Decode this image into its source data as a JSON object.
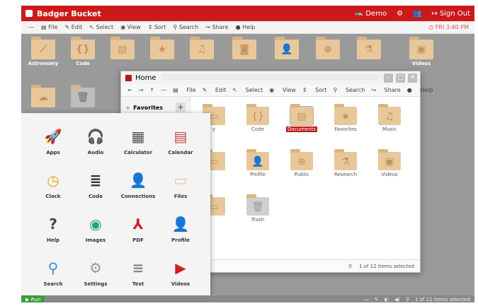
{
  "topbar": {
    "title": "Badger Bucket",
    "user": "Demo",
    "sign_out": "Sign Out"
  },
  "menubar": {
    "items": [
      "File",
      "Edit",
      "Select",
      "View",
      "Sort",
      "Search",
      "Share",
      "Help"
    ],
    "clock": "FRI 3:40 PM"
  },
  "desktop": {
    "icons": [
      {
        "label": "Astronomy",
        "icon": "telescope-icon"
      },
      {
        "label": "Code",
        "icon": "braces-icon"
      },
      {
        "label": "",
        "icon": "document-icon"
      },
      {
        "label": "",
        "icon": "star-icon"
      },
      {
        "label": "",
        "icon": "music-icon"
      },
      {
        "label": "",
        "icon": "camera-icon"
      },
      {
        "label": "",
        "icon": "person-icon"
      },
      {
        "label": "",
        "icon": "globe-icon"
      },
      {
        "label": "",
        "icon": "flask-icon"
      },
      {
        "label": "Videos",
        "icon": "film-icon"
      }
    ]
  },
  "window": {
    "title": "Home",
    "toolbar": [
      "File",
      "Edit",
      "Select",
      "View",
      "Sort",
      "Search",
      "Share",
      "Help"
    ],
    "sidebar_favorites": "Favorites",
    "items": [
      {
        "label": "y",
        "icon": "folder-icon"
      },
      {
        "label": "Code",
        "icon": "braces-icon"
      },
      {
        "label": "Documents",
        "icon": "document-icon",
        "selected": true
      },
      {
        "label": "Favorites",
        "icon": "star-icon"
      },
      {
        "label": "Music",
        "icon": "music-icon"
      },
      {
        "label": "",
        "icon": "folder-icon"
      },
      {
        "label": "Profile",
        "icon": "person-icon"
      },
      {
        "label": "Public",
        "icon": "globe-icon"
      },
      {
        "label": "Research",
        "icon": "flask-icon"
      },
      {
        "label": "Videos",
        "icon": "film-icon"
      },
      {
        "label": "",
        "icon": "folder-icon"
      },
      {
        "label": "Trash",
        "icon": "trash-icon"
      }
    ],
    "status": "1 of 12 items selected"
  },
  "launcher": {
    "apps": [
      {
        "label": "Apps",
        "glyph": "🚀"
      },
      {
        "label": "Audio",
        "glyph": "🎧"
      },
      {
        "label": "Calculator",
        "glyph": "▦"
      },
      {
        "label": "Calendar",
        "glyph": "▤"
      },
      {
        "label": "Clock",
        "glyph": "◷"
      },
      {
        "label": "Code",
        "glyph": "≣"
      },
      {
        "label": "Connections",
        "glyph": "👤"
      },
      {
        "label": "Files",
        "glyph": "▭"
      },
      {
        "label": "Help",
        "glyph": "?"
      },
      {
        "label": "Images",
        "glyph": "◉"
      },
      {
        "label": "PDF",
        "glyph": "⅄"
      },
      {
        "label": "Profile",
        "glyph": "👤"
      },
      {
        "label": "Search",
        "glyph": "⚲"
      },
      {
        "label": "Settings",
        "glyph": "⚙"
      },
      {
        "label": "Text",
        "glyph": "≡"
      },
      {
        "label": "Videos",
        "glyph": "▶"
      }
    ]
  },
  "bottombar": {
    "run": "Run",
    "status": "1 of 12 items selected"
  },
  "colors": {
    "accent": "#cc1a1a",
    "folder": "#e8c89a",
    "run": "#3d9a3d"
  }
}
